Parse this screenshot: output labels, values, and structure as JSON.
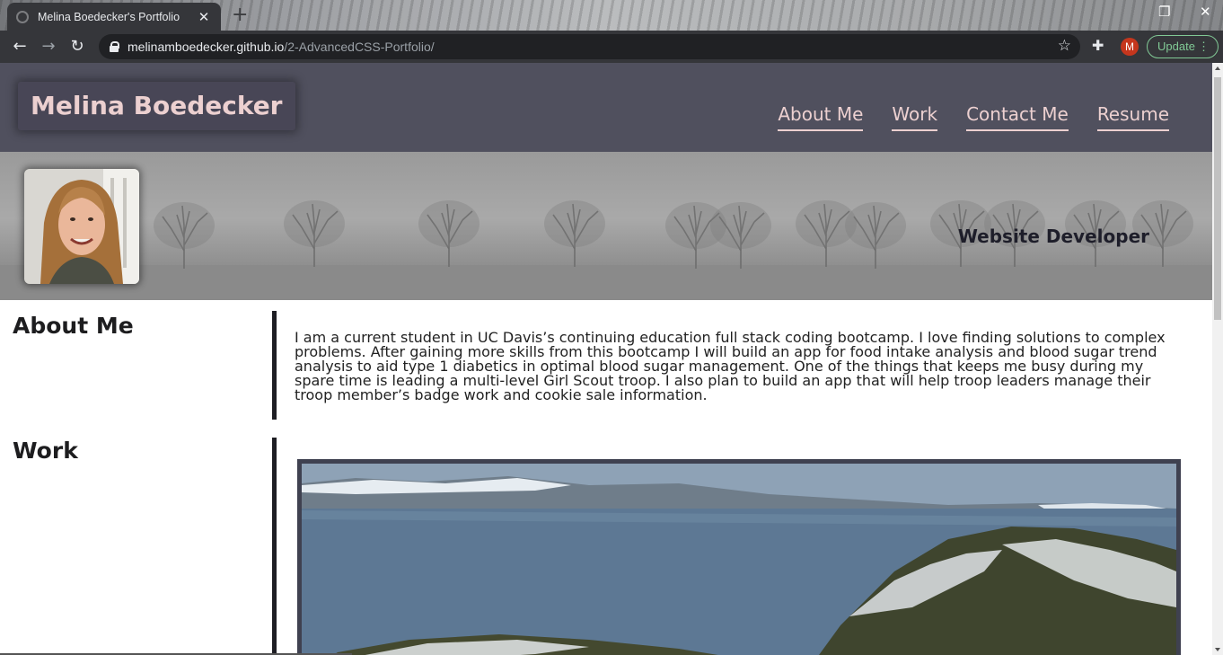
{
  "browser": {
    "tab_title": "Melina Boedecker's Portfolio",
    "tab_close": "✕",
    "new_tab": "+",
    "url_host": "melinamboedecker.github.io",
    "url_path": "/2-AdvancedCSS-Portfolio/",
    "profile_initial": "M",
    "update_label": "Update",
    "update_menu": "⋮",
    "back": "←",
    "forward": "→",
    "reload": "↻",
    "star": "☆",
    "extensions": "✚",
    "restore": "❐",
    "close_window": "✕"
  },
  "site": {
    "brand": "Melina Boedecker",
    "nav": [
      "About Me",
      "Work",
      "Contact Me",
      "Resume"
    ],
    "tagline": "Website Developer",
    "colors": {
      "header_bg": "#50505e",
      "accent_text": "#ecd0d0",
      "section_bar": "#1e1e24"
    }
  },
  "about": {
    "heading": "About Me",
    "text": "I am a current student in UC Davis’s continuing education full stack coding bootcamp. I love finding solutions to complex problems. After gaining more skills from this bootcamp I will build an app for food intake analysis and blood sugar trend analysis to aid type 1 diabetics in optimal blood sugar management. One of the things that keeps me busy during my spare time is leading a multi-level Girl Scout troop. I also plan to build an app that will help troop leaders manage their troop member’s badge work and cookie sale information."
  },
  "work": {
    "heading": "Work"
  }
}
